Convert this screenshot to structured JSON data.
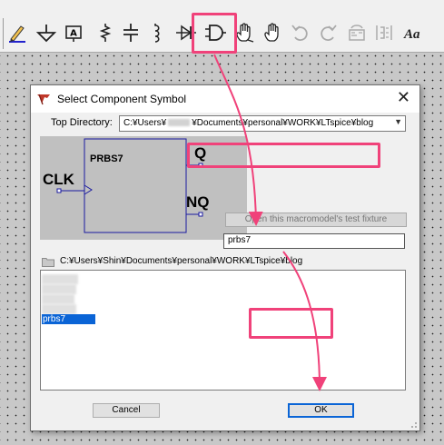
{
  "toolbar": {
    "icons": [
      "pencil-icon",
      "ground-icon",
      "label-icon",
      "resistor-icon",
      "capacitor-icon",
      "inductor-icon",
      "diode-icon",
      "component-icon",
      "drag-hand-icon",
      "move-hand-icon",
      "undo-icon",
      "redo-icon",
      "rotate-icon",
      "mirror-icon",
      "text-icon"
    ]
  },
  "dialog": {
    "title": "Select Component Symbol",
    "close_glyph": "✕",
    "top_directory_label": "Top Directory:",
    "top_directory_value_pre": "C:¥Users¥",
    "top_directory_value_post": "¥Documents¥personal¥WORK¥LTspice¥blog",
    "preview": {
      "component_name": "PRBS7",
      "pin_clk": "CLK",
      "pin_q": "Q",
      "pin_nq": "NQ"
    },
    "fixture_button": "Open this macromodel's test fixture",
    "name_input_value": "prbs7",
    "current_path": "C:¥Users¥Shin¥Documents¥personal¥WORK¥LTspice¥blog",
    "files": [
      {
        "name": "xxxxx",
        "blurred": true
      },
      {
        "name": "xxxxx",
        "blurred": true
      },
      {
        "name": "xxxxx",
        "blurred": true
      },
      {
        "name": "xxxxx",
        "blurred": true
      },
      {
        "name": "prbs7",
        "blurred": false,
        "selected": true
      }
    ],
    "cancel_label": "Cancel",
    "ok_label": "OK"
  },
  "colors": {
    "highlight": "#f0427a",
    "selection": "#0a64d6",
    "pin_blue": "#2020c0"
  }
}
